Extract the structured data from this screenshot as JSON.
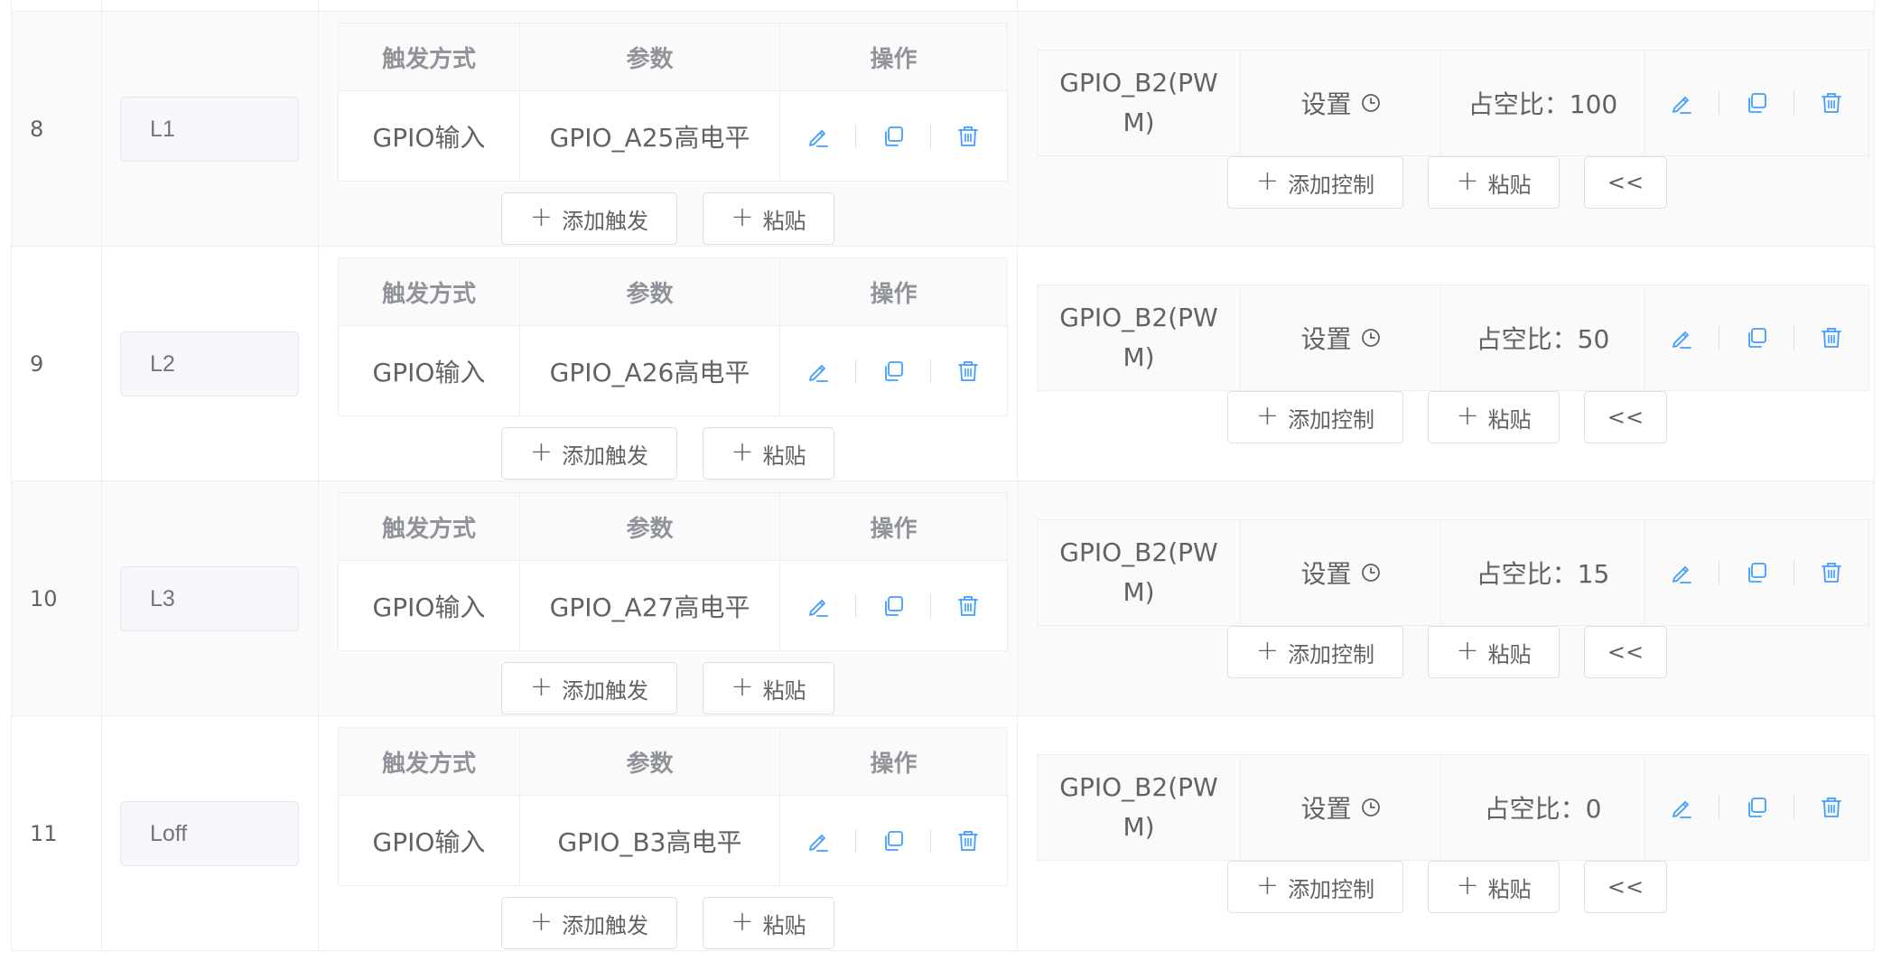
{
  "trigger_table": {
    "headers": [
      "触发方式",
      "参数",
      "操作"
    ]
  },
  "buttons": {
    "add_trigger": "添加触发",
    "paste": "粘贴",
    "add_control": "添加控制",
    "collapse": "<<"
  },
  "rows": [
    {
      "index": "8",
      "name_placeholder": "L1",
      "trigger": {
        "type": "GPIO输入",
        "param": "GPIO_A25高电平"
      },
      "control": {
        "gpio_line1": "GPIO_B2(PW",
        "gpio_line2": "M)",
        "setting": "设置",
        "duty": "占空比：100"
      }
    },
    {
      "index": "9",
      "name_placeholder": "L2",
      "trigger": {
        "type": "GPIO输入",
        "param": "GPIO_A26高电平"
      },
      "control": {
        "gpio_line1": "GPIO_B2(PW",
        "gpio_line2": "M)",
        "setting": "设置",
        "duty": "占空比：50"
      }
    },
    {
      "index": "10",
      "name_placeholder": "L3",
      "trigger": {
        "type": "GPIO输入",
        "param": "GPIO_A27高电平"
      },
      "control": {
        "gpio_line1": "GPIO_B2(PW",
        "gpio_line2": "M)",
        "setting": "设置",
        "duty": "占空比：15"
      }
    },
    {
      "index": "11",
      "name_placeholder": "Loff",
      "trigger": {
        "type": "GPIO输入",
        "param": "GPIO_B3高电平"
      },
      "control": {
        "gpio_line1": "GPIO_B2(PW",
        "gpio_line2": "M)",
        "setting": "设置",
        "duty": "占空比：0"
      }
    }
  ],
  "colors": {
    "icon_blue": "#409eff",
    "border": "#ebeef5",
    "header_text": "#909399",
    "body_text": "#606266",
    "placeholder": "#c0c4cc"
  },
  "icons": {
    "edit": "edit-pen-icon",
    "copy": "copy-icon",
    "delete": "trash-icon",
    "clock": "clock-icon"
  }
}
